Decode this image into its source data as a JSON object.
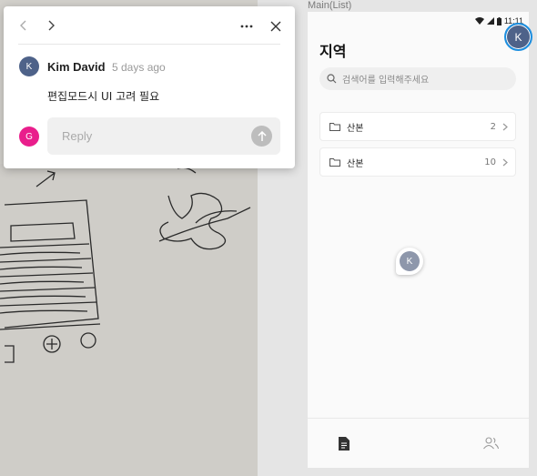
{
  "popup": {
    "author_initial": "K",
    "author_name": "Kim David",
    "timestamp": "5 days ago",
    "body": "편집모드시 UI 고려 필요",
    "reply_avatar_initial": "G",
    "reply_placeholder": "Reply",
    "icons": [
      "chevron-left-icon",
      "chevron-right-icon",
      "more-icon",
      "close-icon",
      "send-arrow-icon"
    ]
  },
  "frame": {
    "label": "Main(List)",
    "status_time": "11:11",
    "title": "지역",
    "search_placeholder": "검색어를 입력해주세요",
    "list": [
      {
        "label": "산본",
        "count": "2"
      },
      {
        "label": "산본",
        "count": "10"
      }
    ],
    "bottom_nav": [
      "document-icon",
      "users-icon"
    ]
  },
  "collaborators": {
    "top_avatar_initial": "K",
    "pin_avatar_initial": "K"
  },
  "colors": {
    "avatar_blue": "#4e6289",
    "avatar_pink": "#e91e8c",
    "selection_blue": "#1d8fe0"
  }
}
